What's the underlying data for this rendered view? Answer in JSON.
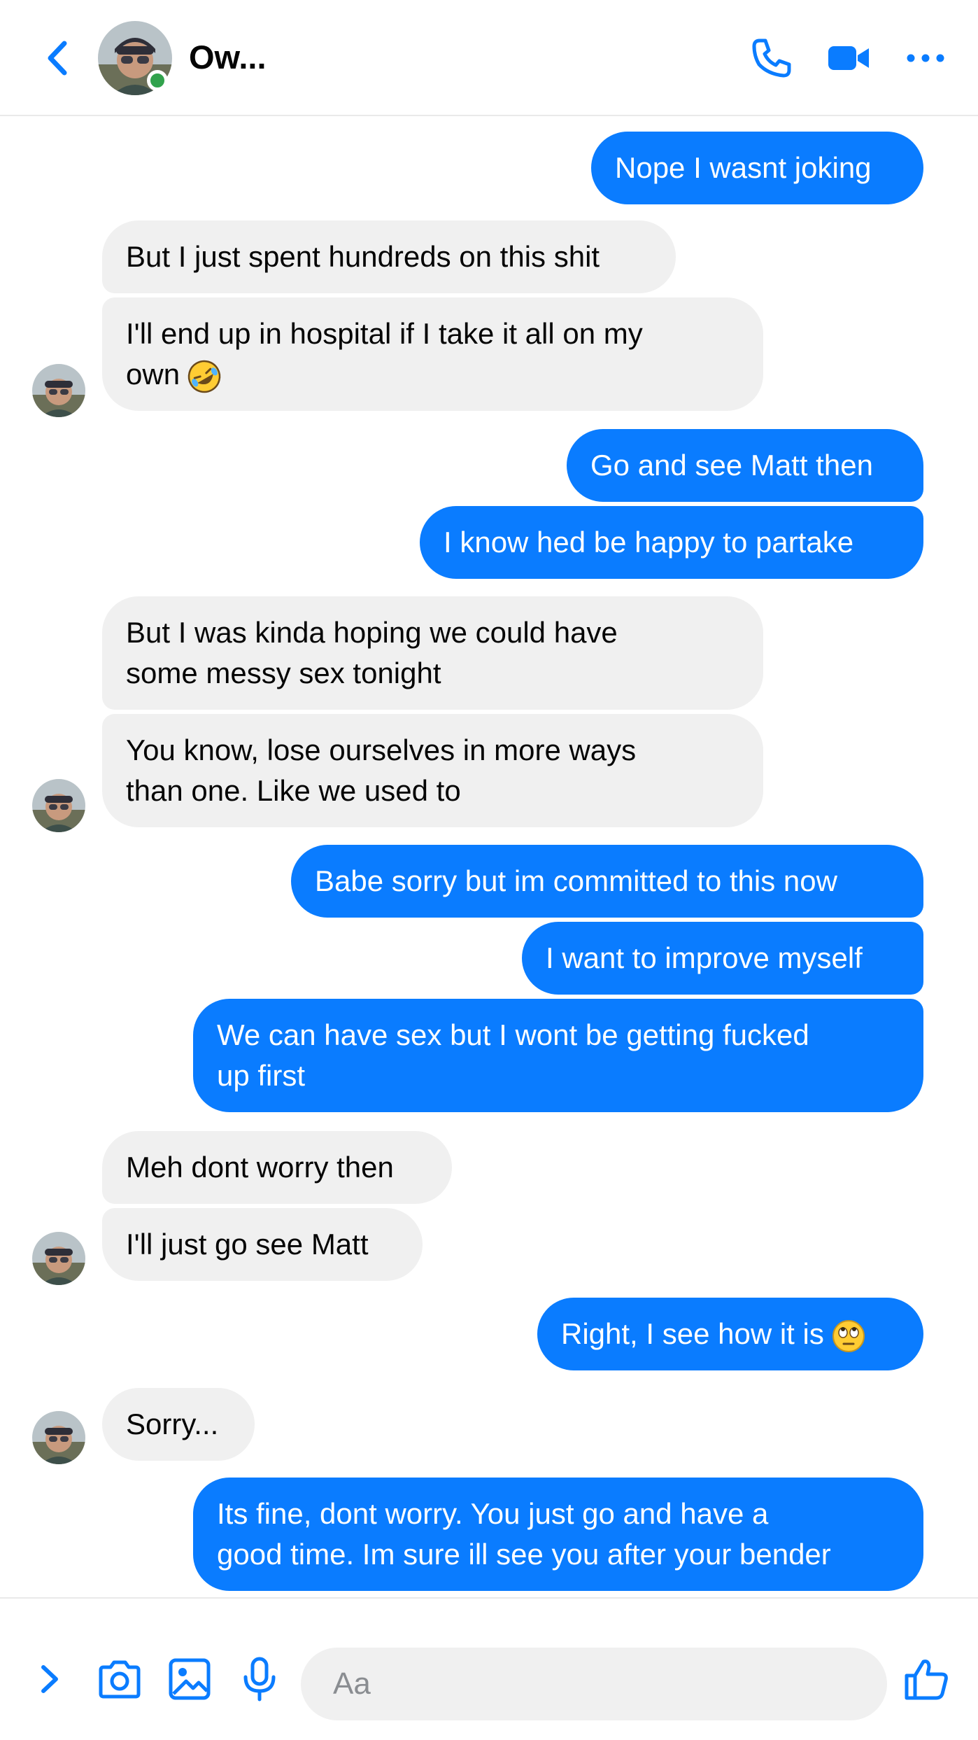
{
  "header": {
    "contact_name": "Ow...",
    "online": true
  },
  "colors": {
    "accent": "#0a7cff",
    "incoming_bubble": "#f0f0f0",
    "online": "#31a24c"
  },
  "messages": [
    {
      "dir": "out",
      "text": "Nope I wasnt joking"
    },
    {
      "dir": "in",
      "text": "But I just spent hundreds on this shit"
    },
    {
      "dir": "in",
      "text": "I'll end up in hospital if I take it all on my\nown",
      "emoji": "rolling-on-floor-laughing"
    },
    {
      "dir": "out",
      "text": "Go and see Matt then"
    },
    {
      "dir": "out",
      "text": "I know hed be happy to partake"
    },
    {
      "dir": "in",
      "text": "But I was kinda hoping we could have\nsome messy sex tonight"
    },
    {
      "dir": "in",
      "text": "You know, lose ourselves in more ways\nthan one. Like we used to"
    },
    {
      "dir": "out",
      "text": "Babe sorry but im committed to this now"
    },
    {
      "dir": "out",
      "text": "I want to improve myself"
    },
    {
      "dir": "out",
      "text": "We can have sex but I wont be getting fucked\nup first"
    },
    {
      "dir": "in",
      "text": "Meh dont worry then"
    },
    {
      "dir": "in",
      "text": "I'll just go see Matt"
    },
    {
      "dir": "out",
      "text": "Right, I see how it is",
      "emoji": "eye-roll"
    },
    {
      "dir": "in",
      "text": "Sorry..."
    },
    {
      "dir": "out",
      "text": "Its fine, dont worry. You just go and have a\ngood time. Im sure ill see you after your bender"
    }
  ],
  "composer": {
    "placeholder": "Aa",
    "icons": [
      "expand-icon",
      "camera-icon",
      "gallery-icon",
      "microphone-icon",
      "thumbs-up-icon"
    ]
  }
}
